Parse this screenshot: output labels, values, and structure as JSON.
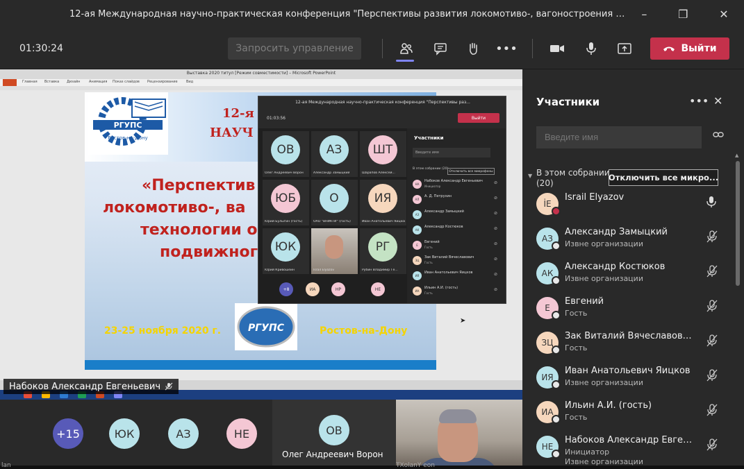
{
  "window": {
    "title": "12-ая Международная научно-практическая конференция \"Перспективы развития локомотиво-, вагоностроения и тех...",
    "controls": [
      "–",
      "❐",
      "✕"
    ]
  },
  "toolbar": {
    "timer": "01:30:24",
    "request_control": "Запросить управление",
    "leave_label": "Выйти",
    "icons": [
      "participants-icon",
      "chat-icon",
      "raise-hand-icon",
      "more-icon",
      "camera-icon",
      "mic-icon",
      "share-icon"
    ]
  },
  "stage": {
    "presenter_name": "Набоков Александр Евгеньевич",
    "ppt_title": "Выставка 2020   титул [Режим совместимости] – Microsoft PowerPoint",
    "ppt_tabs": [
      "Главная",
      "Вставка",
      "Дизайн",
      "Анимация",
      "Показ слайдов",
      "Рецензирование",
      "Вид"
    ],
    "slide": {
      "logo_text": "РГУПС",
      "logo_sub": "Ростов-на-Дону",
      "line1": "12-я",
      "line2": "НАУЧ",
      "line3": "«Перспектив",
      "line4": "локомотиво-, ва",
      "line5": "технологии о",
      "line6": "подвижног",
      "date": "23-25 ноября 2020 г.",
      "city": "Ростов-на-Дону",
      "logo2_text": "РГУПС"
    }
  },
  "nested": {
    "title": "12-ая Международная научно-практическая конференция \"Перспективы раз...",
    "timer": "01:03:56",
    "leave": "Выйти",
    "tiles": [
      {
        "initials": "ОВ",
        "name": "Олег Андреевич Ворон",
        "color": "#b9e3ea"
      },
      {
        "initials": "АЗ",
        "name": "Александр Замыцкий",
        "color": "#b9e3ea"
      },
      {
        "initials": "ШТ",
        "name": "Шарапов Алексей...",
        "color": "#f4c7d4"
      },
      {
        "initials": "ЮБ",
        "name": "Юрий Булыгин (гость)",
        "color": "#f4c7d4"
      },
      {
        "initials": "О",
        "name": "ОАО \"ВНИКТИ\" (гость)",
        "color": "#b9e3ea"
      },
      {
        "initials": "ИЯ",
        "name": "Иван Анатольевич Яицков",
        "color": "#f6d7bd"
      },
      {
        "initials": "ЮК",
        "name": "Юрий Кривошеин",
        "color": "#b9e3ea"
      },
      {
        "initials": "",
        "name": "İsrail Elyazov",
        "color": "#777"
      },
      {
        "initials": "РГ",
        "name": "Рубин Владимир Ге...",
        "color": "#c4e3c4"
      }
    ],
    "bottom": [
      {
        "label": "+8",
        "color": "#585ab8"
      },
      {
        "label": "ИА",
        "color": "#f6d7bd"
      },
      {
        "label": "НР",
        "color": "#f4c7d4"
      },
      {
        "label": "НЕ",
        "color": "#f4c7d4"
      }
    ],
    "panel_title": "Участники",
    "search": "Введите имя",
    "section": "В этом собрании (20)",
    "mute_all": "Отключить все микрофоны",
    "rows": [
      {
        "initials": "НА",
        "name": "Набоков Александр Евгеньевич",
        "sub": "Инициатор",
        "color": "#f4c7d4"
      },
      {
        "initials": "АЛ",
        "name": "А. Д. Петрухин",
        "sub": "",
        "color": "#f4c7d4"
      },
      {
        "initials": "АЗ",
        "name": "Александр Замыцкий",
        "sub": "",
        "color": "#b9e3ea"
      },
      {
        "initials": "АК",
        "name": "Александр Костюков",
        "sub": "",
        "color": "#b9e3ea"
      },
      {
        "initials": "Е",
        "name": "Евгений",
        "sub": "Гость",
        "color": "#f4c7d4"
      },
      {
        "initials": "ЗЦ",
        "name": "Зак Виталий Вячеславович",
        "sub": "Гость",
        "color": "#f6d7bd"
      },
      {
        "initials": "ИЯ",
        "name": "Иван Анатольевич Яицков",
        "sub": "",
        "color": "#b9e3ea"
      },
      {
        "initials": "ИА",
        "name": "Ильин А.И. (гость)",
        "sub": "Гость",
        "color": "#f6d7bd"
      }
    ]
  },
  "bottom_strip": {
    "avatars": [
      {
        "label": "+15",
        "color": "#585ab8"
      },
      {
        "label": "ЮК",
        "color": "#b9e3ea"
      },
      {
        "label": "АЗ",
        "color": "#b9e3ea"
      },
      {
        "label": "НЕ",
        "color": "#f4c7d4"
      }
    ],
    "tile": {
      "initials": "ОВ",
      "name": "Олег Андреевич Ворон",
      "color": "#b9e3ea"
    }
  },
  "panel": {
    "title": "Участники",
    "search_placeholder": "Введите имя",
    "section_label": "В этом собрании",
    "section_count": "(20)",
    "mute_all": "Отключить все микро...",
    "participants": [
      {
        "initials": "İE",
        "name": "İsrail Elyazov",
        "sub": "",
        "sub2": "",
        "color": "#f6d7bd",
        "badge": "red",
        "mic": "on"
      },
      {
        "initials": "АЗ",
        "name": "Александр Замыцкий",
        "sub": "Извне организации",
        "sub2": "",
        "color": "#b9e3ea",
        "badge": "grey",
        "mic": "off"
      },
      {
        "initials": "АК",
        "name": "Александр Костюков",
        "sub": "Извне организации",
        "sub2": "",
        "color": "#b9e3ea",
        "badge": "grey",
        "mic": "off"
      },
      {
        "initials": "Е",
        "name": "Евгений",
        "sub": "Гость",
        "sub2": "",
        "color": "#f4c7d4",
        "badge": "grey",
        "mic": "off"
      },
      {
        "initials": "ЗЦ",
        "name": "Зак Виталий Вячеславович ...",
        "sub": "Гость",
        "sub2": "",
        "color": "#f6d7bd",
        "badge": "grey",
        "mic": "off"
      },
      {
        "initials": "ИЯ",
        "name": "Иван Анатольевич Яицков",
        "sub": "Извне организации",
        "sub2": "",
        "color": "#b9e3ea",
        "badge": "grey",
        "mic": "off"
      },
      {
        "initials": "ИА",
        "name": "Ильин А.И. (гость)",
        "sub": "Гость",
        "sub2": "",
        "color": "#f6d7bd",
        "badge": "grey",
        "mic": "off"
      },
      {
        "initials": "НЕ",
        "name": "Набоков Александр Евгенье...",
        "sub": "Инициатор",
        "sub2": "Извне организации",
        "color": "#b9e3ea",
        "badge": "grey",
        "mic": "off"
      }
    ]
  },
  "taskbar": {
    "left_text": "lan",
    "right_text": "TXolanY   eon"
  }
}
